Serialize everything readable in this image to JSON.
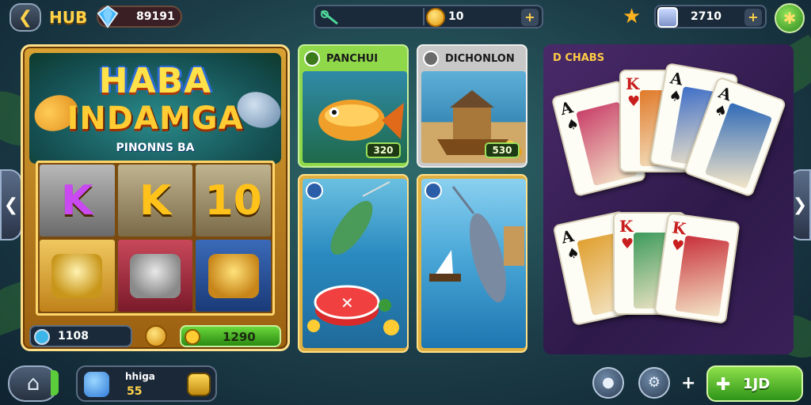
{
  "topbar": {
    "hub_label": "HUB",
    "gems": "89191",
    "center_value": "10",
    "tickets": "2710"
  },
  "slot": {
    "title_line1": "HABA",
    "title_line2": "INDAMGA",
    "subtitle": "PINONNS BA",
    "reels": [
      "K",
      "K",
      "10"
    ],
    "balance": "1108",
    "win": "1290"
  },
  "tiles": [
    {
      "title": "PANCHUI",
      "price": "320",
      "header_color": "#8fd84a",
      "art_top": "#2f8aa8",
      "art_bottom": "#1f6a4a"
    },
    {
      "title": "DICHONLON",
      "price": "530",
      "header_color": "#c8c8c8",
      "art_top": "#5eb0d8",
      "art_bottom": "#d0a868"
    },
    {
      "title": "",
      "price": "",
      "header_color": "#e0b040",
      "art_top": "#6ac0e0",
      "art_bottom": "#1f6a9a"
    },
    {
      "title": "",
      "price": "",
      "header_color": "#e0b040",
      "art_top": "#8ad0f0",
      "art_bottom": "#1e76b0"
    }
  ],
  "card_panel": {
    "title": "D CHABS",
    "cards_top": [
      {
        "rank": "A",
        "suit": "♠",
        "color": "#111111",
        "face": "#c9406a"
      },
      {
        "rank": "K",
        "suit": "♥",
        "color": "#c81e1e",
        "face": "#e07a2a"
      },
      {
        "rank": "A",
        "suit": "♠",
        "color": "#111111",
        "face": "#3f6fc8"
      },
      {
        "rank": "A",
        "suit": "♠",
        "color": "#111111",
        "face": "#2f6ab8"
      }
    ],
    "cards_bottom": [
      {
        "rank": "A",
        "suit": "♠",
        "color": "#111111",
        "face": "#e0a030"
      },
      {
        "rank": "K",
        "suit": "♥",
        "color": "#c81e1e",
        "face": "#3c9a5a"
      },
      {
        "rank": "K",
        "suit": "♥",
        "color": "#c81e1e",
        "face": "#c8303a"
      }
    ]
  },
  "bottombar": {
    "player_name": "hhiga",
    "player_level": "55",
    "play_label": "1JD"
  },
  "colors": {
    "accent_gold": "#ffd34a",
    "accent_green": "#5ccd3a"
  }
}
